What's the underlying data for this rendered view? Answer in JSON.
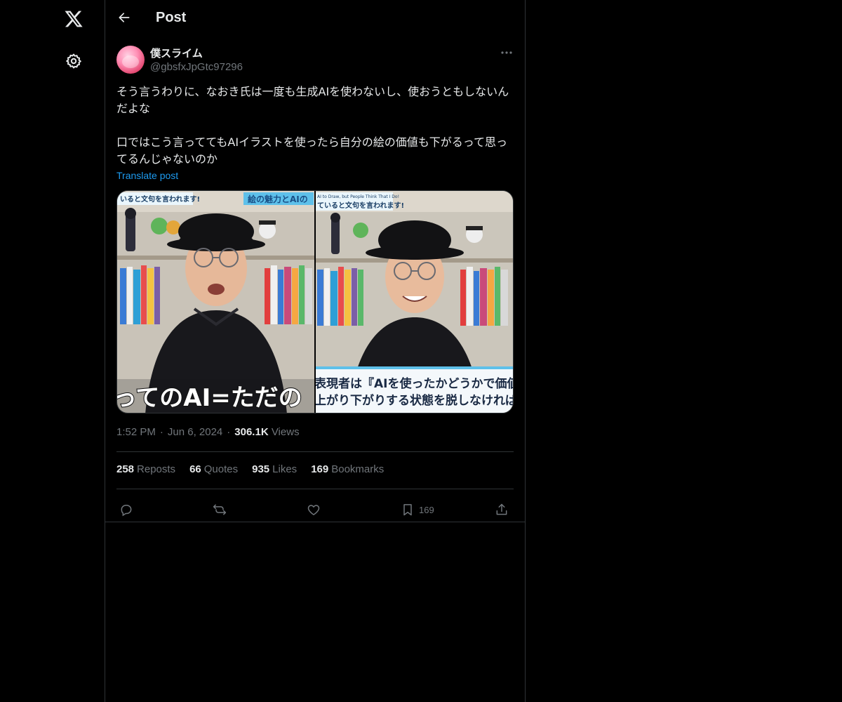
{
  "nav": {
    "logo_icon": "x-logo-icon",
    "settings_icon": "gear-icon"
  },
  "header": {
    "title": "Post"
  },
  "post": {
    "author": {
      "display_name": "僕スライム",
      "handle": "@gbsfxJpGtc97296"
    },
    "text": "そう言うわりに、なおき氏は一度も生成AIを使わないし、使おうともしないんだよな\n\n口ではこう言っててもAIイラストを使ったら自分の絵の価値も下がるって思ってるんじゃないのか",
    "translate_label": "Translate post",
    "media": [
      {
        "banner_top_left": "いると文句を言われます!",
        "banner_top_right": "絵の魅力とAIの",
        "caption": "ってのAI=ただの"
      },
      {
        "banner_top": "AI to Draw, but People Think That I Do!\nていると文句を言われます!",
        "caption_line1": "表現者は『AIを使ったかどうかで価値",
        "caption_line2": "上がり下がりする状態を脱しなければ"
      }
    ],
    "time": "1:52 PM",
    "date": "Jun 6, 2024",
    "views_count": "306.1K",
    "views_label": "Views",
    "stats": {
      "reposts_count": "258",
      "reposts_label": "Reposts",
      "quotes_count": "66",
      "quotes_label": "Quotes",
      "likes_count": "935",
      "likes_label": "Likes",
      "bookmarks_count": "169",
      "bookmarks_label": "Bookmarks"
    },
    "actions": {
      "bookmark_count": "169"
    }
  },
  "colors": {
    "background": "#000000",
    "text_primary": "#e7e9ea",
    "text_secondary": "#71767b",
    "accent": "#1d9bf0",
    "border": "#2f3336"
  }
}
